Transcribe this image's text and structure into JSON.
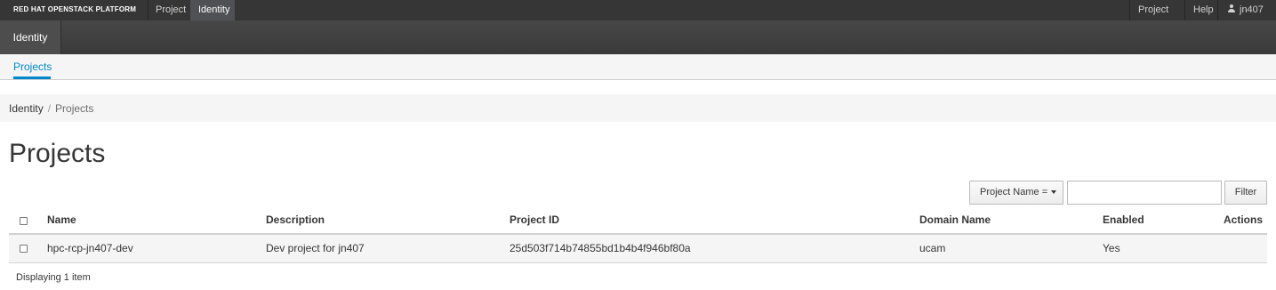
{
  "topbar": {
    "brand": "RED HAT OPENSTACK PLATFORM",
    "nav": [
      "Project",
      "Identity"
    ],
    "right": {
      "project_menu": "Project",
      "help": "Help",
      "user": "jn407"
    }
  },
  "secondary": {
    "tab": "Identity"
  },
  "tabs": {
    "projects": "Projects"
  },
  "breadcrumb": {
    "root": "Identity",
    "separator": "/",
    "current": "Projects"
  },
  "page": {
    "title": "Projects"
  },
  "filter": {
    "select_label": "Project Name =",
    "input_value": "",
    "button": "Filter"
  },
  "table": {
    "headers": [
      "Name",
      "Description",
      "Project ID",
      "Domain Name",
      "Enabled",
      "Actions"
    ],
    "rows": [
      [
        "hpc-rcp-jn407-dev",
        "Dev project for jn407",
        "25d503f714b74855bd1b4b4f946bf80a",
        "ucam",
        "Yes"
      ]
    ],
    "footer": "Displaying 1 item"
  },
  "colors": {
    "topbar": "#363636",
    "accent": "#0088ce",
    "secondary_bar": "#3f3f3f"
  }
}
